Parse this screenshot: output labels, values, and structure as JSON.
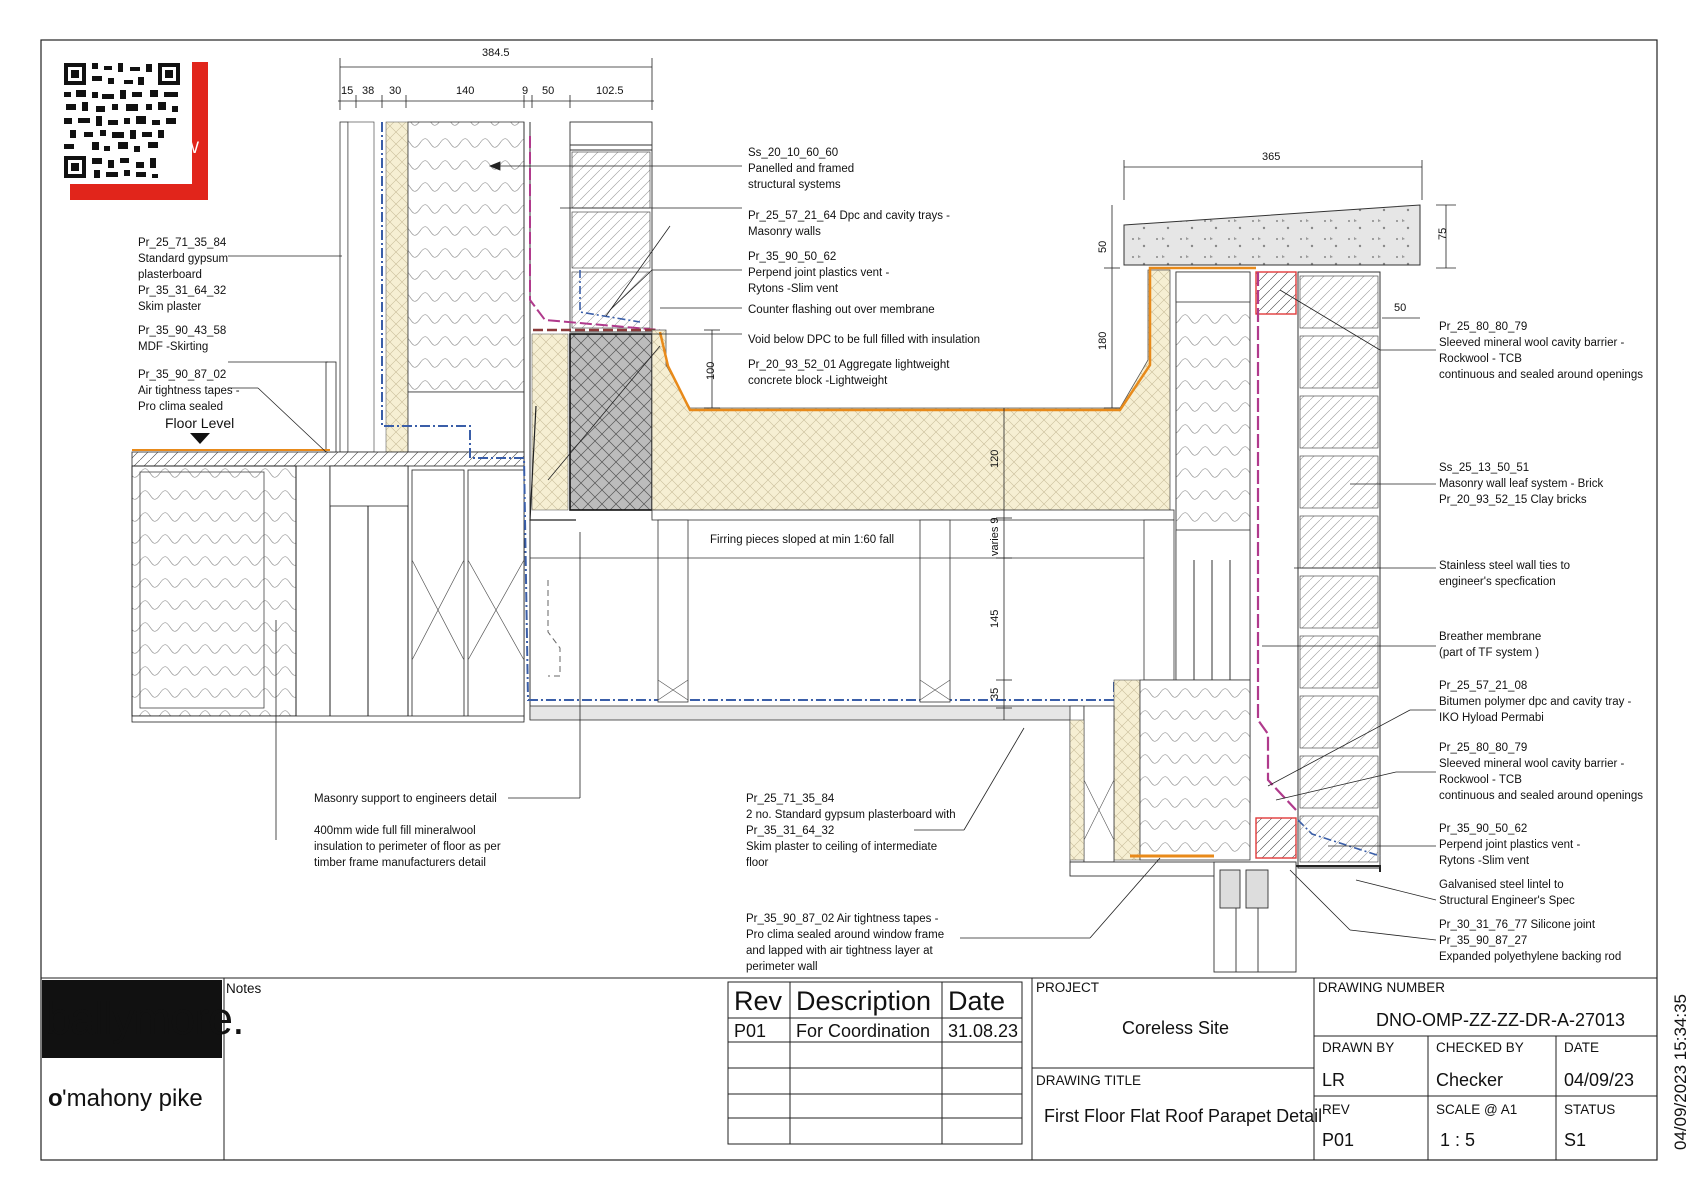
{
  "logo": {
    "qr_letter": "W",
    "client": "ballymore.",
    "architect_mark": "o",
    "architect_name": "'mahony pike"
  },
  "dimensions": {
    "top_total": "384.5",
    "top_parts": [
      "15",
      "38",
      "30",
      "140",
      "9",
      "50",
      "102.5"
    ],
    "parapet_width": "365",
    "coping_depth": "75",
    "coping_edge": "50",
    "coping_drop": "50",
    "upstand": "180",
    "block_gap": "100",
    "insulation": "120",
    "firring": "varies 9",
    "joist": "145",
    "batten": "35"
  },
  "annotations": {
    "floor_level": "Floor Level",
    "firring_note": "Firring pieces sloped at min 1:60 fall",
    "left": [
      [
        "Pr_25_71_35_84",
        "Standard gypsum",
        "plasterboard",
        "Pr_35_31_64_32",
        "Skim plaster"
      ],
      [
        "Pr_35_90_43_58",
        "MDF -Skirting"
      ],
      [
        "Pr_35_90_87_02",
        "Air tightness tapes -",
        "Pro clima sealed"
      ]
    ],
    "center": [
      [
        "Ss_20_10_60_60",
        "Panelled and framed",
        "structural systems"
      ],
      [
        "Pr_25_57_21_64 Dpc and cavity trays -",
        "Masonry walls"
      ],
      [
        "Pr_35_90_50_62",
        "Perpend joint plastics vent -",
        "Rytons -Slim vent"
      ],
      [
        "Counter flashing out over membrane"
      ],
      [
        "Void below DPC to be full filled with insulation"
      ],
      [
        "Pr_20_93_52_01 Aggregate lightweight",
        "concrete block -Lightweight"
      ]
    ],
    "bottom_left": [
      [
        "Masonry support to engineers detail"
      ],
      [
        "400mm wide full fill mineralwool",
        "insulation to perimeter of floor as per",
        "timber frame manufacturers detail"
      ]
    ],
    "bottom_center": [
      [
        "Pr_25_71_35_84",
        "2 no. Standard gypsum plasterboard with",
        "Pr_35_31_64_32",
        "Skim plaster to ceiling of intermediate",
        "floor"
      ],
      [
        "Pr_35_90_87_02 Air tightness tapes -",
        "Pro clima sealed around window frame",
        "and lapped with air tightness layer at",
        "perimeter wall"
      ]
    ],
    "right": [
      [
        "Pr_25_80_80_79",
        "Sleeved mineral wool cavity barrier -",
        "Rockwool - TCB",
        "continuous and sealed around openings"
      ],
      [
        "Ss_25_13_50_51",
        "Masonry wall leaf system - Brick",
        "Pr_20_93_52_15 Clay bricks"
      ],
      [
        "Stainless steel wall ties to",
        "engineer's specfication"
      ],
      [
        "Breather membrane",
        "(part of TF system )"
      ],
      [
        "Pr_25_57_21_08",
        "Bitumen polymer dpc and cavity tray -",
        "IKO Hyload Permabi"
      ],
      [
        "Pr_25_80_80_79",
        "Sleeved mineral wool cavity barrier -",
        "Rockwool - TCB",
        "continuous and sealed around openings"
      ],
      [
        "Pr_35_90_50_62",
        "Perpend joint plastics vent -",
        "Rytons -Slim vent"
      ],
      [
        "Galvanised steel lintel to",
        "Structural Engineer's Spec"
      ],
      [
        "Pr_30_31_76_77  Silicone joint",
        "Pr_35_90_87_27",
        "Expanded polyethylene backing rod"
      ]
    ]
  },
  "title_block": {
    "notes_label": "Notes",
    "rev_headers": [
      "Rev",
      "Description",
      "Date"
    ],
    "rev_rows": [
      [
        "P01",
        "For Coordination",
        "31.08.23"
      ]
    ],
    "project_label": "PROJECT",
    "project": "Coreless Site",
    "drawing_title_label": "DRAWING TITLE",
    "drawing_title": "First Floor Flat Roof Parapet Detail",
    "drawing_number_label": "DRAWING NUMBER",
    "drawing_number": "DNO-OMP-ZZ-ZZ-DR-A-27013",
    "drawn_by_label": "DRAWN BY",
    "drawn_by": "LR",
    "checked_by_label": "CHECKED BY",
    "checked_by": "Checker",
    "date_label": "DATE",
    "date": "04/09/23",
    "rev_label": "REV",
    "rev": "P01",
    "scale_label": "SCALE @ A1",
    "scale": "1 : 5",
    "status_label": "STATUS",
    "status": "S1",
    "timestamp": "04/09/2023 15:34:35"
  },
  "colors": {
    "insulation_fill": "#f6efd3",
    "block_fill": "#bdbdbd",
    "air_tightness_line": "#3a5ea8",
    "membrane_line": "#b03a8c",
    "dpc_line": "#e88a1a",
    "fire_barrier": "#e23a3a",
    "logo_red": "#e1251b"
  }
}
